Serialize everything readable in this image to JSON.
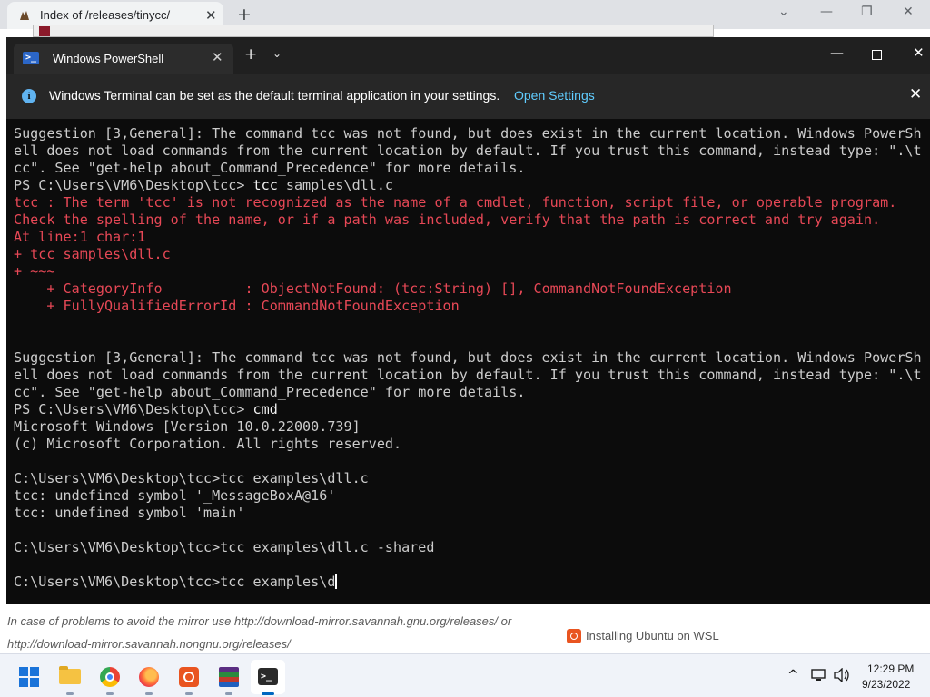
{
  "browser": {
    "tab_title": "Index of /releases/tinycc/",
    "close_glyph": "✕",
    "newtab_glyph": "+",
    "min_glyph": "⌄",
    "max_glyph": "—",
    "restore_glyph": "❐",
    "close_window_glyph": "✕",
    "mirror_notice_prefix": "In case of problems to avoid the mirror use ",
    "mirror_link_1": "http://download-mirror.savannah.gnu.org/releases/",
    "mirror_notice_or": " or ",
    "mirror_link_2": "http://download-mirror.savannah.nongnu.org/releases/"
  },
  "terminal": {
    "tab_title": "Windows PowerShell",
    "tab_close": "✕",
    "new_tab": "+",
    "dropdown": "⌄",
    "minimize": "—",
    "close": "✕",
    "info_message": "Windows Terminal can be set as the default terminal application in your settings.",
    "info_link": "Open Settings",
    "info_close": "✕",
    "lines": {
      "l1": "Suggestion [3,General]: The command tcc was not found, but does exist in the current location. Windows PowerSh",
      "l2": "ell does not load commands from the current location by default. If you trust this command, instead type: \".\\t",
      "l3": "cc\". See \"get-help about_Command_Precedence\" for more details.",
      "l4_prompt": "PS C:\\Users\\VM6\\Desktop\\tcc> ",
      "l4_cmd": "tcc",
      "l4_args": " samples\\dll.c",
      "l5": "tcc : The term 'tcc' is not recognized as the name of a cmdlet, function, script file, or operable program.",
      "l6": "Check the spelling of the name, or if a path was included, verify that the path is correct and try again.",
      "l7": "At line:1 char:1",
      "l8": "+ tcc samples\\dll.c",
      "l9": "+ ~~~",
      "l10": "    + CategoryInfo          : ObjectNotFound: (tcc:String) [], CommandNotFoundException",
      "l11": "    + FullyQualifiedErrorId : CommandNotFoundException",
      "l12": "Suggestion [3,General]: The command tcc was not found, but does exist in the current location. Windows PowerSh",
      "l13": "ell does not load commands from the current location by default. If you trust this command, instead type: \".\\t",
      "l14": "cc\". See \"get-help about_Command_Precedence\" for more details.",
      "l15_prompt": "PS C:\\Users\\VM6\\Desktop\\tcc> ",
      "l15_cmd": "cmd",
      "l16": "Microsoft Windows [Version 10.0.22000.739]",
      "l17": "(c) Microsoft Corporation. All rights reserved.",
      "l18": "C:\\Users\\VM6\\Desktop\\tcc>tcc examples\\dll.c",
      "l19": "tcc: undefined symbol '_MessageBoxA@16'",
      "l20": "tcc: undefined symbol 'main'",
      "l21": "C:\\Users\\VM6\\Desktop\\tcc>tcc examples\\dll.c -shared",
      "l22": "C:\\Users\\VM6\\Desktop\\tcc>tcc examples\\d"
    }
  },
  "notification": {
    "text": "Installing Ubuntu on WSL"
  },
  "taskbar": {
    "apps": [
      "start",
      "file-explorer",
      "chrome",
      "firefox",
      "ubuntu",
      "winrar",
      "windows-terminal"
    ],
    "active_app": "windows-terminal",
    "tray_chevron": "^",
    "time": "12:29 PM",
    "date": "9/23/2022"
  },
  "colors": {
    "terminal_bg": "#0c0c0c",
    "terminal_text": "#cccccc",
    "error_text": "#e74856",
    "info_link": "#60cdff",
    "accent": "#0067c0"
  }
}
